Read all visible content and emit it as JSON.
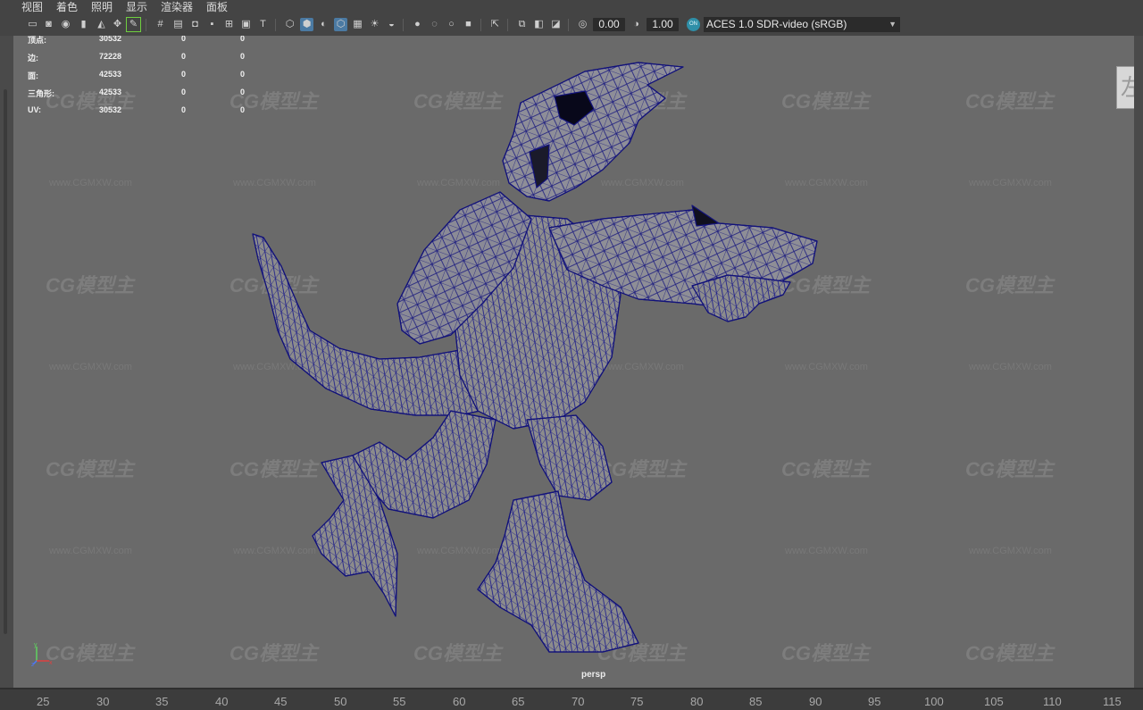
{
  "menu": [
    "视图",
    "着色",
    "照明",
    "显示",
    "渲染器",
    "面板"
  ],
  "toolbar": {
    "icons": [
      "camera-select-icon",
      "camera-attributes-icon",
      "camera-bookmark-icon",
      "bookmark-icon",
      "image-plane-icon",
      "2d-pan-zoom-icon",
      "grease-pencil-icon",
      "grid-icon",
      "film-gate-icon",
      "resolution-gate-icon",
      "gate-mask-icon",
      "field-chart-icon",
      "safe-action-icon",
      "safe-title-icon",
      "wireframe-icon",
      "smooth-shade-icon",
      "use-default-material-icon",
      "wireframe-on-shaded-icon",
      "xray-icon",
      "use-all-lights-icon",
      "shadows-icon",
      "screen-space-ao-icon",
      "motion-blur-icon",
      "anti-aliasing-icon",
      "depth-of-field-icon",
      "isolate-select-icon",
      "xray-joints-icon",
      "xray-active-icon",
      "backface-culling-icon",
      "exposure-icon",
      "gamma-icon"
    ],
    "exposure_value": "0.00",
    "gamma_value": "1.00",
    "color_management_icon": "color-management-icon",
    "color_management_label": "ON",
    "color_space": "ACES 1.0 SDR-video (sRGB)"
  },
  "hud": {
    "rows": [
      {
        "label": "顶点:",
        "total": "30532",
        "selected": "0",
        "highlighted": "0"
      },
      {
        "label": "边:",
        "total": "72228",
        "selected": "0",
        "highlighted": "0"
      },
      {
        "label": "面:",
        "total": "42533",
        "selected": "0",
        "highlighted": "0"
      },
      {
        "label": "三角形:",
        "total": "42533",
        "selected": "0",
        "highlighted": "0"
      },
      {
        "label": "UV:",
        "total": "30532",
        "selected": "0",
        "highlighted": "0"
      }
    ]
  },
  "viewport": {
    "camera_label": "persp",
    "viewcube_face": "左",
    "axis_labels": {
      "y": "y",
      "x": "x",
      "z": "z"
    },
    "watermark_logo": "CG模型主",
    "watermark_url": "www.CGMXW.com",
    "background_color": "#6a6a6a",
    "wireframe_color": "#1a1a8a"
  },
  "timeline": {
    "ticks": [
      "25",
      "30",
      "35",
      "40",
      "45",
      "50",
      "55",
      "60",
      "65",
      "70",
      "75",
      "80",
      "85",
      "90",
      "95",
      "100",
      "105",
      "110",
      "115"
    ]
  }
}
